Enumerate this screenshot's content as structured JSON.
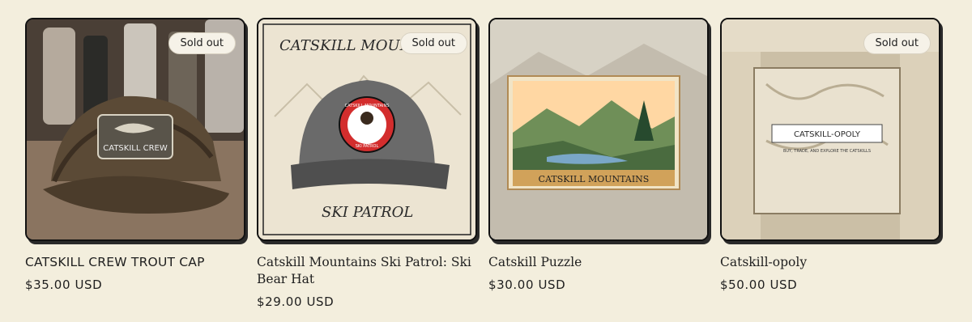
{
  "products": [
    {
      "title": "CATSKILL CREW TROUT CAP",
      "price": "$35.00 USD",
      "badge": "Sold out",
      "patch_text": "CATSKILL CREW"
    },
    {
      "title": "Catskill Mountains Ski Patrol: Ski Bear Hat",
      "price": "$29.00 USD",
      "badge": "Sold out",
      "art_top": "CATSKILL MOUN",
      "art_bottom": "SKI PATROL",
      "patch_top": "CATSKILL MOUNTAINS",
      "patch_bottom": "SKI PATROL"
    },
    {
      "title": "Catskill Puzzle",
      "price": "$30.00 USD",
      "badge": "",
      "banner": "CATSKILL MOUNTAINS"
    },
    {
      "title": "Catskill-opoly",
      "price": "$50.00 USD",
      "badge": "Sold out",
      "box_title": "CATSKILL-OPOLY",
      "box_subtitle": "BUY, TRADE, AND EXPLORE THE CATSKILLS"
    }
  ],
  "colors": {
    "page_bg": "#f3eedd",
    "badge_bg": "#f6f2e8"
  }
}
